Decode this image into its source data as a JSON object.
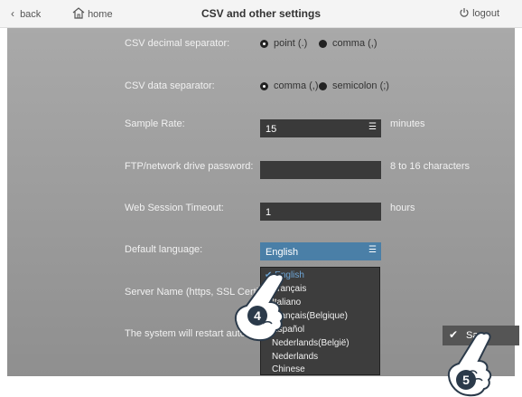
{
  "header": {
    "back_label": "back",
    "home_label": "home",
    "title": "CSV and other settings",
    "logout_label": "logout"
  },
  "settings": {
    "csv_decimal_label": "CSV decimal separator:",
    "csv_decimal_options": [
      "point (.)",
      "comma (,)"
    ],
    "csv_data_label": "CSV data separator:",
    "csv_data_options": [
      "comma (,)",
      "semicolon (;)"
    ],
    "sample_rate_label": "Sample Rate:",
    "sample_rate_value": "15",
    "sample_rate_unit": "minutes",
    "ftp_label": "FTP/network drive password:",
    "ftp_value": "",
    "ftp_hint": "8 to 16 characters",
    "timeout_label": "Web Session Timeout:",
    "timeout_value": "1",
    "timeout_unit": "hours",
    "language_label": "Default language:",
    "language_value": "English",
    "server_label": "Server Name (https, SSL Certificate)",
    "restart_label": "The system will restart automa"
  },
  "dropdown": {
    "options": [
      "English",
      "Français",
      "Italiano",
      "Français(Belgique)",
      "Español",
      "Nederlands(België)",
      "Nederlands",
      "Chinese"
    ],
    "selected_mark": "✔"
  },
  "save_label": "Save",
  "annotations": {
    "step_4": "4",
    "step_5": "5"
  },
  "colors": {
    "panel": "#9e9e9e",
    "field": "#3a3a3a",
    "select_accent": "#4a7fa7",
    "dropdown_bg": "#3d3d3d",
    "selected_text": "#6ea7d8"
  }
}
